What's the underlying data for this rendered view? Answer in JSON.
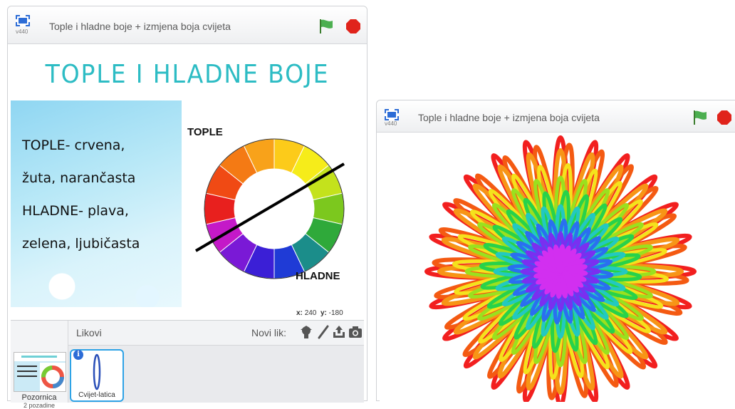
{
  "window1": {
    "version": "v440",
    "title": "Tople i hladne boje + izmjena boja cvijeta",
    "stage": {
      "heading": "TOPLE I HLADNE BOJE",
      "lines": [
        "TOPLE- crvena,",
        "žuta, narančasta",
        "HLADNE- plava,",
        "zelena, ljubičasta"
      ],
      "wheel_top_label": "TOPLE",
      "wheel_bottom_label": "HLADNE"
    },
    "coords": {
      "x_label": "x:",
      "x": "240",
      "y_label": "y:",
      "y": "-180"
    },
    "sprites": {
      "header": "Likovi",
      "new_sprite_label": "Novi lik:",
      "tools": [
        "choose-sprite-icon",
        "paint-icon",
        "upload-icon",
        "camera-icon"
      ],
      "stage_label": "Pozornica",
      "stage_sub": "2 pozadine",
      "sprite_name": "Cvijet-latica"
    }
  },
  "window2": {
    "version": "v440",
    "title": "Tople i hladne boje + izmjena boja cvijeta"
  },
  "colors": {
    "flag": "#4caf50",
    "stop": "#e0231b",
    "accent": "#2fa3e6",
    "title_teal": "#2dbcc4"
  }
}
